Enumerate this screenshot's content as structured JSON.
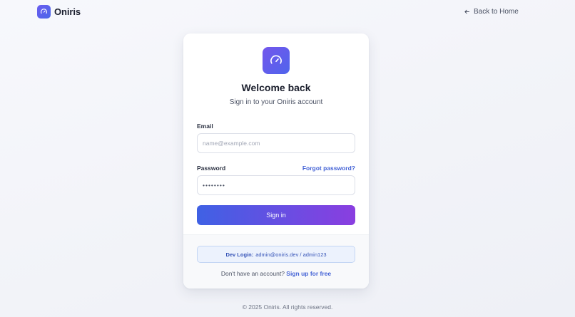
{
  "header": {
    "brand_name": "Oniris",
    "back_link_label": "Back to Home"
  },
  "card": {
    "title": "Welcome back",
    "subtitle": "Sign in to your Oniris account",
    "email": {
      "label": "Email",
      "placeholder": "name@example.com",
      "value": ""
    },
    "password": {
      "label": "Password",
      "placeholder": "••••••••",
      "forgot_label": "Forgot password?"
    },
    "signin_label": "Sign in",
    "dev_login": {
      "label": "Dev Login:",
      "credentials": "admin@oniris.dev / admin123"
    },
    "signup": {
      "prompt": "Don't have an account?",
      "link_label": "Sign up for free"
    }
  },
  "footer": {
    "copyright": "© 2025 Oniris. All rights reserved."
  },
  "colors": {
    "brand_gradient_start": "#6a5cf0",
    "brand_gradient_end": "#4a67e8",
    "button_gradient_start": "#3f61e4",
    "button_gradient_end": "#8a3ee0",
    "link": "#4463d6"
  },
  "icons": {
    "brand_logo": "speedometer-icon",
    "back_link": "arrow-left-icon",
    "card_logo": "speedometer-icon"
  }
}
